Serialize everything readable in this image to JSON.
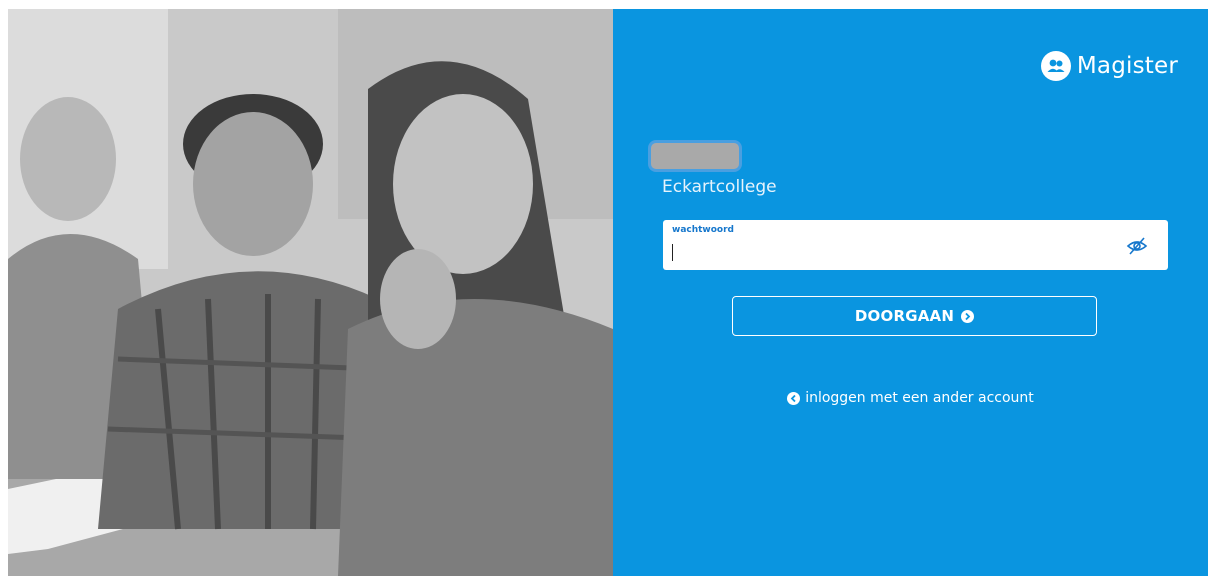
{
  "brand": {
    "name": "Magister",
    "icon": "people-icon"
  },
  "login": {
    "school_name": "Eckartcollege",
    "password_label": "wachtwoord",
    "password_value": "",
    "show_password_icon": "eye-slash-icon",
    "continue_label": "DOORGAAN",
    "continue_icon": "chevron-right-circle-icon",
    "alt_account_label": "inloggen met een ander account",
    "alt_account_icon": "chevron-left-circle-icon"
  },
  "colors": {
    "panel_bg": "#0a95e0",
    "label_blue": "#1677cc"
  }
}
